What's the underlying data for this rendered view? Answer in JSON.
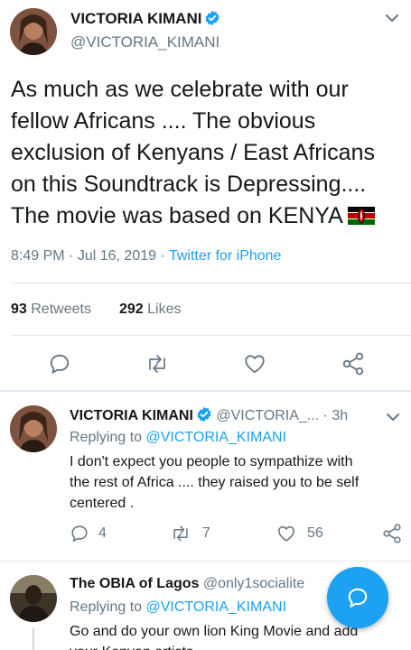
{
  "main_tweet": {
    "name": "VICTORIA KIMANI",
    "handle": "@VICTORIA_KIMANI",
    "text_lines": [
      "As much as we celebrate with our",
      "fellow Africans .... The obvious",
      "exclusion of Kenyans / East Africans",
      "on this Soundtrack is Depressing....",
      "The movie was based on KENYA"
    ],
    "time": "8:49 PM",
    "date": "Jul 16, 2019",
    "sep": "·",
    "source": "Twitter for iPhone",
    "retweets_count": "93",
    "retweets_label": "Retweets",
    "likes_count": "292",
    "likes_label": "Likes"
  },
  "reply1": {
    "name": "VICTORIA KIMANI",
    "handle": "@VICTORIA_...",
    "time": "· 3h",
    "replying_prefix": "Replying to",
    "replying_handle": "@VICTORIA_KIMANI",
    "text_lines": [
      "I don't expect you people to sympathize with",
      "the rest of Africa .... they raised you to be self",
      "centered ."
    ],
    "reply_count": "4",
    "retweet_count": "7",
    "like_count": "56"
  },
  "reply2": {
    "name": "The OBIA of Lagos",
    "handle": "@only1socialite",
    "replying_prefix": "Replying to",
    "replying_handle": "@VICTORIA_KIMANI",
    "text_lines": [
      "Go and do your own lion King Movie and add",
      "your Kenyan artists"
    ]
  },
  "colors": {
    "accent": "#1da1f2",
    "text": "#14171a",
    "secondary": "#657786",
    "divider": "#e1e8ed"
  },
  "icons": {
    "verified": "verified-badge-icon",
    "chevron": "chevron-down-icon",
    "reply": "reply-icon",
    "retweet": "retweet-icon",
    "like": "heart-icon",
    "share": "share-icon",
    "flag": "kenya-flag-icon",
    "compose": "compose-reply-icon"
  }
}
